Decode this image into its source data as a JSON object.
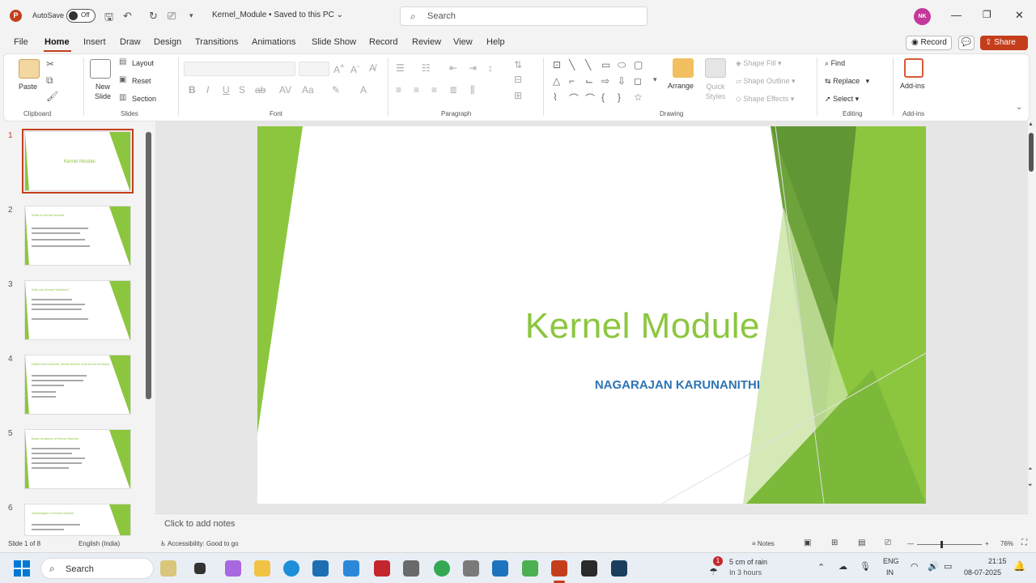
{
  "app": {
    "logo_letter": "P",
    "autosave_label": "AutoSave",
    "autosave_state": "Off",
    "document_title": "Kernel_Module • Saved to this PC ⌄",
    "search_placeholder": "Search",
    "user_initials": "NK"
  },
  "tabs": [
    "File",
    "Home",
    "Insert",
    "Draw",
    "Design",
    "Transitions",
    "Animations",
    "Slide Show",
    "Record",
    "Review",
    "View",
    "Help"
  ],
  "active_tab": "Home",
  "actions": {
    "record": "Record",
    "share": "Share"
  },
  "ribbon": {
    "clipboard": {
      "paste": "Paste",
      "label": "Clipboard"
    },
    "slides": {
      "new_slide": "New Slide",
      "layout": "Layout",
      "reset": "Reset",
      "section": "Section",
      "label": "Slides"
    },
    "font": {
      "label": "Font"
    },
    "paragraph": {
      "label": "Paragraph"
    },
    "drawing": {
      "arrange": "Arrange",
      "quick_styles": "Quick Styles",
      "shape_fill": "Shape Fill",
      "shape_outline": "Shape Outline",
      "shape_effects": "Shape Effects",
      "label": "Drawing"
    },
    "editing": {
      "find": "Find",
      "replace": "Replace",
      "select": "Select",
      "label": "Editing"
    },
    "addins": {
      "addins": "Add-ins",
      "label": "Add-ins"
    }
  },
  "thumbnails": [
    {
      "number": "1",
      "title": "Kernel Module"
    },
    {
      "number": "2",
      "title": "What is Kernel Module"
    },
    {
      "number": "3",
      "title": "Why use Kernel Modules?"
    },
    {
      "number": "4",
      "title": "Difference between device drivers and kernel modules"
    },
    {
      "number": "5",
      "title": "Basic Anatomy of Kernel Module"
    },
    {
      "number": "6",
      "title": "Advantages of Kernel Module"
    }
  ],
  "slide": {
    "title": "Kernel  Module",
    "subtitle": "NAGARAJAN KARUNANITHI"
  },
  "notes_placeholder": "Click to add notes",
  "status": {
    "slide_count": "Slide 1 of 8",
    "language": "English (India)",
    "accessibility": "Accessibility: Good to go",
    "notes": "Notes",
    "zoom": "76%"
  },
  "taskbar": {
    "search": "Search",
    "weather_line1": "5 cm of rain",
    "weather_line2": "In 3 hours",
    "weather_badge": "1",
    "lang1": "ENG",
    "lang2": "IN",
    "time": "21:15",
    "date": "08-07-2025"
  },
  "colors": {
    "accent": "#c43e1c",
    "slide_green": "#8cc63e",
    "slide_blue": "#2e74b5"
  }
}
